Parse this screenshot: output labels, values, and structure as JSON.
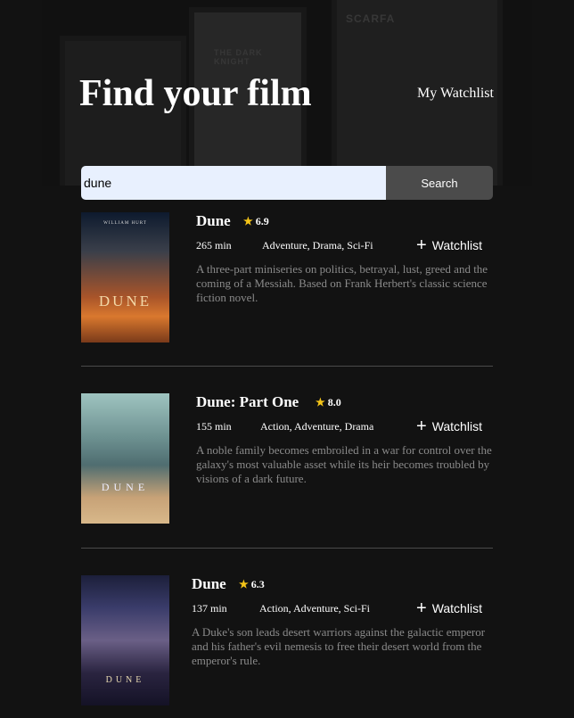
{
  "header": {
    "title": "Find your film",
    "watchlist_link": "My Watchlist",
    "backdrop": {
      "poster_left": "",
      "poster_middle": "THE DARK KNIGHT",
      "poster_right": "SCARFA"
    }
  },
  "search": {
    "value": "dune",
    "button_label": "Search"
  },
  "results": [
    {
      "title": "Dune",
      "rating": "6.9",
      "runtime": "265 min",
      "genres": "Adventure, Drama, Sci-Fi",
      "watchlist_label": "Watchlist",
      "plot": "A three-part miniseries on politics, betrayal, lust, greed and the coming of a Messiah. Based on Frank Herbert's classic science fiction novel.",
      "poster_text": "DUNE",
      "poster_top": "WILLIAM HURT"
    },
    {
      "title": "Dune: Part One",
      "rating": "8.0",
      "runtime": "155 min",
      "genres": "Action, Adventure, Drama",
      "watchlist_label": "Watchlist",
      "plot": "A noble family becomes embroiled in a war for control over the galaxy's most valuable asset while its heir becomes troubled by visions of a dark future.",
      "poster_text": "DUNE",
      "poster_top": ""
    },
    {
      "title": "Dune",
      "rating": "6.3",
      "runtime": "137 min",
      "genres": "Action, Adventure, Sci-Fi",
      "watchlist_label": "Watchlist",
      "plot": "A Duke's son leads desert warriors against the galactic emperor and his father's evil nemesis to free their desert world from the emperor's rule.",
      "poster_text": "DUNE",
      "poster_top": ""
    }
  ],
  "icons": {
    "star": "star-icon",
    "plus": "plus-icon"
  },
  "colors": {
    "background": "#121212",
    "star": "#f5c518",
    "button": "#4b4b4b",
    "input_bg": "#e8f0fe",
    "muted_text": "#8a8a8a"
  }
}
